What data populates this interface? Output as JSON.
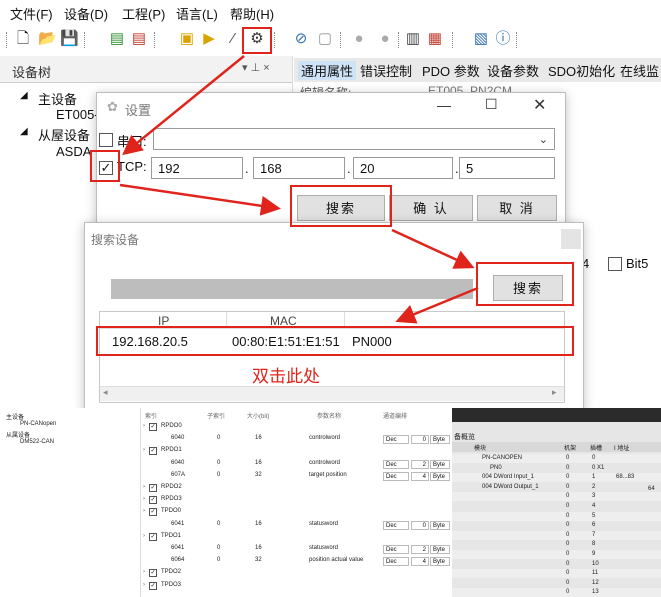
{
  "menu": [
    "文件(F)",
    "设备(D)",
    "工程(P)",
    "语言(L)",
    "帮助(H)"
  ],
  "tree": {
    "title": "设备树",
    "pin": "▾ ⊥ ×",
    "master_label": "主设备",
    "master_child": "ET005-",
    "slave_label": "从屋设备",
    "slave_child": "ASDA"
  },
  "tabs": [
    "通用属性",
    "错误控制",
    "PDO 参数",
    "设备参数",
    "SDO初始化",
    "在线监"
  ],
  "behind": {
    "edit_name_label": "编辑名称:",
    "edit_name_value": "ET005_PN2CM",
    "bit4": "4",
    "bit5": "Bit5"
  },
  "settings_dialog": {
    "title": "设置",
    "serial_label": "串口:",
    "tcp_label": "TCP:",
    "ip": [
      "192",
      "168",
      "20",
      "5"
    ],
    "dots": ".",
    "search_btn": "搜索",
    "ok_btn": "确 认",
    "cancel_btn": "取 消"
  },
  "search_dialog": {
    "title": "搜索设备",
    "search_btn": "搜索",
    "columns": [
      "IP",
      "MAC"
    ],
    "row": {
      "ip": "192.168.20.5",
      "mac": "00:80:E1:51:E1:51",
      "name": "PN000"
    },
    "hint": "双击此处"
  },
  "bottom_left": {
    "tree": [
      "主设备",
      "PN-CANopen",
      "从属设备",
      "DM522-CAN"
    ],
    "headers": [
      "索引",
      "子索引",
      "大小(bit)",
      "参数名称",
      "通道编排"
    ],
    "rows": [
      {
        "chk": true,
        "name": "RPDO0",
        "idx": "",
        "sub": "",
        "size": "",
        "param": "",
        "fmt": "",
        "val": "",
        "unit": ""
      },
      {
        "chk": false,
        "name": "",
        "idx": "6040",
        "sub": "0",
        "size": "16",
        "param": "controlword",
        "fmt": "Dec",
        "val": "0",
        "unit": "Byte"
      },
      {
        "chk": true,
        "name": "RPDO1",
        "idx": "",
        "sub": "",
        "size": "",
        "param": "",
        "fmt": "",
        "val": "",
        "unit": ""
      },
      {
        "chk": false,
        "name": "",
        "idx": "6040",
        "sub": "0",
        "size": "16",
        "param": "controlword",
        "fmt": "Dec",
        "val": "2",
        "unit": "Byte"
      },
      {
        "chk": false,
        "name": "",
        "idx": "607A",
        "sub": "0",
        "size": "32",
        "param": "target position",
        "fmt": "Dec",
        "val": "4",
        "unit": "Byte"
      },
      {
        "chk": true,
        "name": "RPDO2",
        "idx": "",
        "sub": "",
        "size": "",
        "param": "",
        "fmt": "",
        "val": "",
        "unit": ""
      },
      {
        "chk": true,
        "name": "RPDO3",
        "idx": "",
        "sub": "",
        "size": "",
        "param": "",
        "fmt": "",
        "val": "",
        "unit": ""
      },
      {
        "chk": true,
        "name": "TPDO0",
        "idx": "",
        "sub": "",
        "size": "",
        "param": "",
        "fmt": "",
        "val": "",
        "unit": ""
      },
      {
        "chk": false,
        "name": "",
        "idx": "6041",
        "sub": "0",
        "size": "16",
        "param": "statusword",
        "fmt": "Dec",
        "val": "0",
        "unit": "Byte"
      },
      {
        "chk": true,
        "name": "TPDO1",
        "idx": "",
        "sub": "",
        "size": "",
        "param": "",
        "fmt": "",
        "val": "",
        "unit": ""
      },
      {
        "chk": false,
        "name": "",
        "idx": "6041",
        "sub": "0",
        "size": "16",
        "param": "statusword",
        "fmt": "Dec",
        "val": "2",
        "unit": "Byte"
      },
      {
        "chk": false,
        "name": "",
        "idx": "6064",
        "sub": "0",
        "size": "32",
        "param": "position actual value",
        "fmt": "Dec",
        "val": "4",
        "unit": "Byte"
      },
      {
        "chk": true,
        "name": "TPDO2",
        "idx": "",
        "sub": "",
        "size": "",
        "param": "",
        "fmt": "",
        "val": "",
        "unit": ""
      },
      {
        "chk": true,
        "name": "TPDO3",
        "idx": "",
        "sub": "",
        "size": "",
        "param": "",
        "fmt": "",
        "val": "",
        "unit": ""
      }
    ]
  },
  "bottom_right": {
    "title": "备概览",
    "headers": [
      "模块",
      "机架",
      "插槽",
      "I 地址"
    ],
    "rows": [
      {
        "m": "PN-CANOPEN",
        "r": "0",
        "s": "0",
        "a": ""
      },
      {
        "m": "PN0",
        "r": "0",
        "s": "0 X1",
        "a": ""
      },
      {
        "m": "004 DWord Input_1",
        "r": "0",
        "s": "1",
        "a": "68...83"
      },
      {
        "m": "004 DWord Output_1",
        "r": "0",
        "s": "2",
        "a": ""
      },
      {
        "m": "",
        "r": "0",
        "s": "3",
        "a": ""
      },
      {
        "m": "",
        "r": "0",
        "s": "4",
        "a": ""
      },
      {
        "m": "",
        "r": "0",
        "s": "5",
        "a": ""
      },
      {
        "m": "",
        "r": "0",
        "s": "6",
        "a": ""
      },
      {
        "m": "",
        "r": "0",
        "s": "7",
        "a": ""
      },
      {
        "m": "",
        "r": "0",
        "s": "8",
        "a": ""
      },
      {
        "m": "",
        "r": "0",
        "s": "9",
        "a": ""
      },
      {
        "m": "",
        "r": "0",
        "s": "10",
        "a": ""
      },
      {
        "m": "",
        "r": "0",
        "s": "11",
        "a": ""
      },
      {
        "m": "",
        "r": "0",
        "s": "12",
        "a": ""
      },
      {
        "m": "",
        "r": "0",
        "s": "13",
        "a": ""
      }
    ],
    "extra": "64"
  },
  "colors": {
    "annotation_red": "#e0241b",
    "hint_red": "#e0241b",
    "selected_blue": "#cfe3f7"
  }
}
